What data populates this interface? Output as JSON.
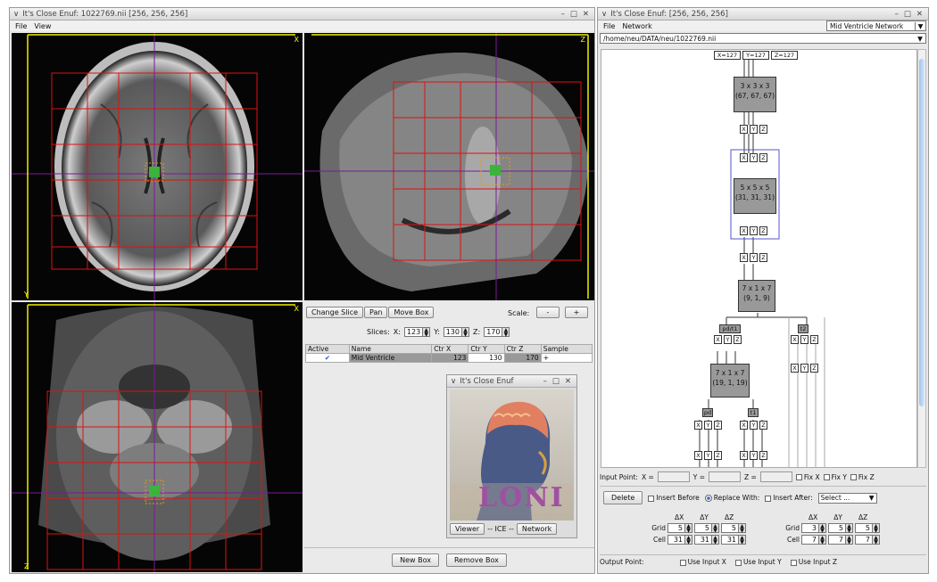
{
  "left_window": {
    "title": "It's Close Enuf:  1022769.nii  [256, 256, 256]",
    "menu": [
      "File",
      "View"
    ],
    "axis_labels": {
      "axial_x": "X",
      "axial_y": "Y",
      "sag_z": "Z",
      "cor_x": "X",
      "cor_z": "Z"
    },
    "controls": {
      "buttons": [
        "Change Slice",
        "Pan",
        "Move Box"
      ],
      "scale_label": "Scale:",
      "scale_minus": "-",
      "scale_plus": "+",
      "slices_label": "Slices:",
      "x_label": "X:",
      "x_value": "123",
      "y_label": "Y:",
      "y_value": "130",
      "z_label": "Z:",
      "z_value": "170"
    },
    "table": {
      "headers": [
        "Active",
        "Name",
        "Ctr X",
        "Ctr Y",
        "Ctr Z",
        "Sample"
      ],
      "row": {
        "active": "✔",
        "name": "Mid Ventricle",
        "ctr_x": "123",
        "ctr_y": "130",
        "ctr_z": "170",
        "sample": "+"
      }
    },
    "new_box": "New Box",
    "remove_box": "Remove Box"
  },
  "about_window": {
    "title": "It's Close Enuf",
    "logo_text": "LONI",
    "tabs": [
      "Viewer",
      "-- ICE --",
      "Network"
    ]
  },
  "right_window": {
    "title": "It's Close Enuf:  [256, 256, 256]",
    "menu": [
      "File",
      "Network"
    ],
    "network_select": "Mid Ventricle Network",
    "path": "/home/neu/DATA/neu/1022769.nii",
    "root_inputs": [
      "X=127",
      "Y=127",
      "Z=127"
    ],
    "nodes": [
      {
        "size": "3 x 3 x 3",
        "coords": "(67, 67, 67)"
      },
      {
        "size": "5 x 5 x 5",
        "coords": "(31, 31, 31)"
      },
      {
        "size": "7 x 1 x 7",
        "coords": "(9, 1, 9)"
      },
      {
        "size": "7 x 1 x 7",
        "coords": "(19, 1, 19)"
      }
    ],
    "port_labels": [
      "X",
      "Y",
      "Z"
    ],
    "branch_tags": [
      "pd/t1",
      "t2",
      "pd",
      "t1"
    ],
    "input_point": {
      "label": "Input Point:",
      "x": "X =",
      "y": "Y =",
      "z": "Z =",
      "fix_x": "Fix X",
      "fix_y": "Fix Y",
      "fix_z": "Fix Z"
    },
    "actions": {
      "delete": "Delete",
      "insert_before": "Insert Before",
      "replace_with": "Replace With:",
      "insert_after": "Insert After:",
      "select": "Select ..."
    },
    "grid_left": {
      "dx": "ΔX",
      "dy": "ΔY",
      "dz": "ΔZ",
      "grid_label": "Grid",
      "cell_label": "Cell",
      "grid": [
        "5",
        "5",
        "5"
      ],
      "cell": [
        "31",
        "31",
        "31"
      ]
    },
    "grid_right": {
      "dx": "ΔX",
      "dy": "ΔY",
      "dz": "ΔZ",
      "grid_label": "Grid",
      "cell_label": "Cell",
      "grid": [
        "3",
        "5",
        "5"
      ],
      "cell": [
        "7",
        "7",
        "7"
      ]
    },
    "output_point": {
      "label": "Output Point:",
      "use_x": "Use Input X",
      "use_y": "Use Input Y",
      "use_z": "Use Input Z"
    }
  }
}
